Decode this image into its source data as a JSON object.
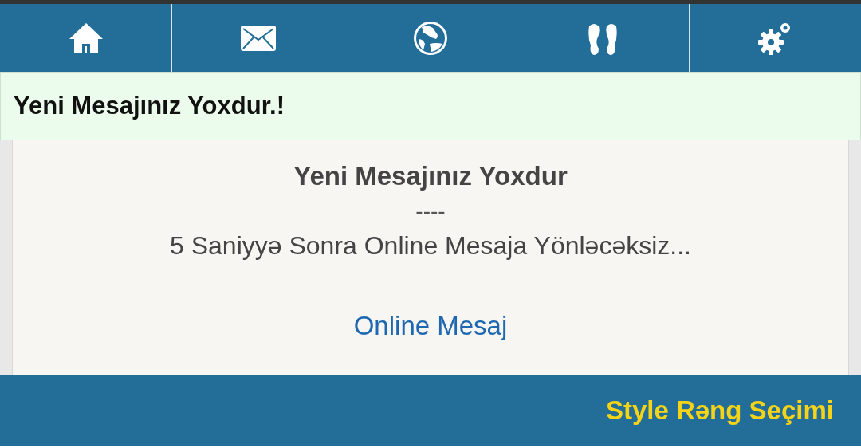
{
  "nav": [
    {
      "kind": "home"
    },
    {
      "kind": "mail"
    },
    {
      "kind": "globe"
    },
    {
      "kind": "footprints"
    },
    {
      "kind": "settings"
    }
  ],
  "notice": "Yeni Mesajınız Yoxdur.!",
  "message": {
    "title": "Yeni Mesajınız Yoxdur",
    "separator": "----",
    "text": "5 Saniyyə Sonra Online Mesaja Yönləcəksiz..."
  },
  "link": "Online Mesaj",
  "footer": {
    "link": "Style Rəng Seçimi"
  }
}
